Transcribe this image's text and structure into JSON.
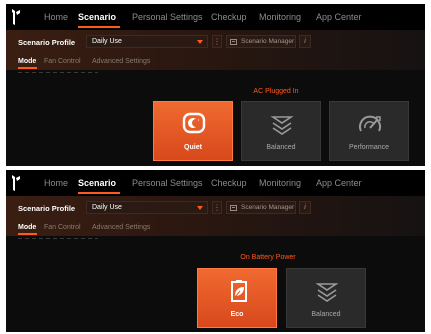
{
  "brand": {
    "accent": "#ff5a1a",
    "card_selected": "#e85a24",
    "card_default": "#2a2a2a"
  },
  "panels": [
    {
      "nav": [
        "Home",
        "Scenario",
        "Personal Settings",
        "Checkup",
        "Monitoring",
        "App Center"
      ],
      "active_nav": "Scenario",
      "profile_label": "Scenario Profile",
      "profile_value": "Daily Use",
      "more_icon": "more-vertical-icon",
      "manager_label": "Scenario Manager",
      "info_icon": "info-icon",
      "subtabs": [
        "Mode",
        "Fan Control",
        "Advanced Settings"
      ],
      "active_subtab": "Mode",
      "power_title": "AC Plugged In",
      "modes": [
        {
          "label": "Quiet",
          "icon": "quiet-moon-icon",
          "selected": true
        },
        {
          "label": "Balanced",
          "icon": "balanced-chevrons-icon",
          "selected": false
        },
        {
          "label": "Performance",
          "icon": "performance-gauge-icon",
          "selected": false
        }
      ]
    },
    {
      "nav": [
        "Home",
        "Scenario",
        "Personal Settings",
        "Checkup",
        "Monitoring",
        "App Center"
      ],
      "active_nav": "Scenario",
      "profile_label": "Scenario Profile",
      "profile_value": "Daily Use",
      "more_icon": "more-vertical-icon",
      "manager_label": "Scenario Manager",
      "info_icon": "info-icon",
      "subtabs": [
        "Mode",
        "Fan Control",
        "Advanced Settings"
      ],
      "active_subtab": "Mode",
      "power_title": "On Battery Power",
      "modes": [
        {
          "label": "Eco",
          "icon": "eco-battery-leaf-icon",
          "selected": true
        },
        {
          "label": "Balanced",
          "icon": "balanced-chevrons-icon",
          "selected": false
        }
      ]
    }
  ]
}
